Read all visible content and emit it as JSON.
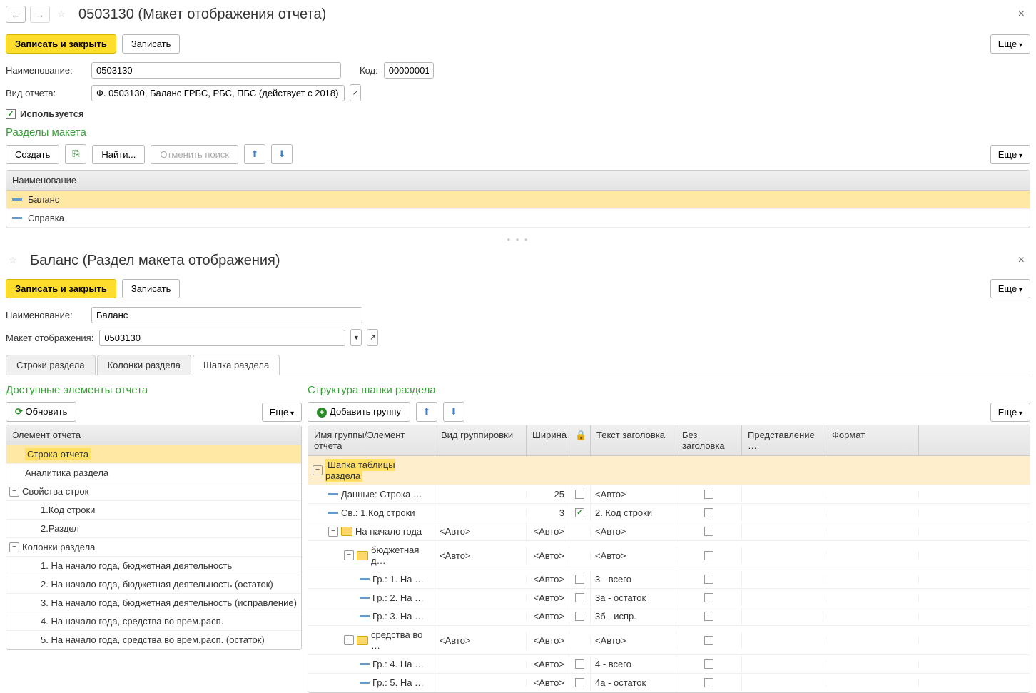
{
  "top": {
    "title": "0503130 (Макет отображения отчета)",
    "save_close": "Записать и закрыть",
    "save": "Записать",
    "more": "Еще",
    "fields": {
      "name_label": "Наименование:",
      "name_value": "0503130",
      "code_label": "Код:",
      "code_value": "00000001",
      "report_label": "Вид отчета:",
      "report_value": "Ф. 0503130, Баланс ГРБС, РБС, ПБС (действует с 2018)",
      "used_label": "Используется"
    },
    "sections": {
      "title": "Разделы макета",
      "create": "Создать",
      "find": "Найти...",
      "cancel_find": "Отменить поиск",
      "header": "Наименование",
      "rows": [
        "Баланс",
        "Справка"
      ]
    }
  },
  "bottom": {
    "title": "Баланс (Раздел макета отображения)",
    "save_close": "Записать и закрыть",
    "save": "Записать",
    "more": "Еще",
    "fields": {
      "name_label": "Наименование:",
      "name_value": "Баланс",
      "layout_label": "Макет отображения:",
      "layout_value": "0503130"
    },
    "tabs": [
      "Строки раздела",
      "Колонки раздела",
      "Шапка раздела"
    ],
    "left_panel": {
      "title": "Доступные элементы отчета",
      "refresh": "Обновить",
      "header": "Элемент отчета",
      "tree": [
        {
          "label": "Строка отчета",
          "indent": 1,
          "selected": true
        },
        {
          "label": "Аналитика раздела",
          "indent": 1
        },
        {
          "label": "Свойства строк",
          "indent": 0,
          "expander": true
        },
        {
          "label": "1.Код строки",
          "indent": 2
        },
        {
          "label": "2.Раздел",
          "indent": 2
        },
        {
          "label": "Колонки раздела",
          "indent": 0,
          "expander": true
        },
        {
          "label": "1. На начало года, бюджетная деятельность",
          "indent": 2
        },
        {
          "label": "2. На начало года, бюджетная деятельность (остаток)",
          "indent": 2
        },
        {
          "label": "3. На начало года, бюджетная деятельность (исправление)",
          "indent": 2
        },
        {
          "label": "4. На начало года, средства во врем.расп.",
          "indent": 2
        },
        {
          "label": "5. На начало года, средства во врем.расп. (остаток)",
          "indent": 2
        }
      ]
    },
    "right_panel": {
      "title": "Структура шапки раздела",
      "add_group": "Добавить группу",
      "cols": {
        "name": "Имя группы/Элемент отчета",
        "group": "Вид группировки",
        "width": "Ширина",
        "text": "Текст заголовка",
        "notext": "Без заголовка",
        "repr": "Представление …",
        "fmt": "Формат"
      },
      "rows": [
        {
          "name": "Шапка таблицы раздела",
          "indent": 0,
          "expander": true,
          "folder": false,
          "selected": true,
          "highlight": true
        },
        {
          "name": "Данные: Строка …",
          "indent": 1,
          "line": true,
          "width": "25",
          "chk": false,
          "text": "<Авто>"
        },
        {
          "name": "Св.: 1.Код строки",
          "indent": 1,
          "line": true,
          "width": "3",
          "chk": true,
          "text": "2. Код строки"
        },
        {
          "name": "На начало года",
          "indent": 1,
          "expander": true,
          "folder": true,
          "group": "<Авто>",
          "width": "<Авто>",
          "text": "<Авто>"
        },
        {
          "name": "бюджетная д…",
          "indent": 2,
          "expander": true,
          "folder": true,
          "group": "<Авто>",
          "width": "<Авто>",
          "text": "<Авто>"
        },
        {
          "name": "Гр.: 1. На …",
          "indent": 3,
          "line": true,
          "width": "<Авто>",
          "chk": false,
          "text": "3 - всего"
        },
        {
          "name": "Гр.: 2. На …",
          "indent": 3,
          "line": true,
          "width": "<Авто>",
          "chk": false,
          "text": "3а - остаток"
        },
        {
          "name": "Гр.: 3. На …",
          "indent": 3,
          "line": true,
          "width": "<Авто>",
          "chk": false,
          "text": "3б - испр."
        },
        {
          "name": "средства во …",
          "indent": 2,
          "expander": true,
          "folder": true,
          "group": "<Авто>",
          "width": "<Авто>",
          "text": "<Авто>"
        },
        {
          "name": "Гр.: 4. На …",
          "indent": 3,
          "line": true,
          "width": "<Авто>",
          "chk": false,
          "text": "4 - всего"
        },
        {
          "name": "Гр.: 5. На …",
          "indent": 3,
          "line": true,
          "width": "<Авто>",
          "chk": false,
          "text": "4а - остаток"
        }
      ]
    }
  }
}
